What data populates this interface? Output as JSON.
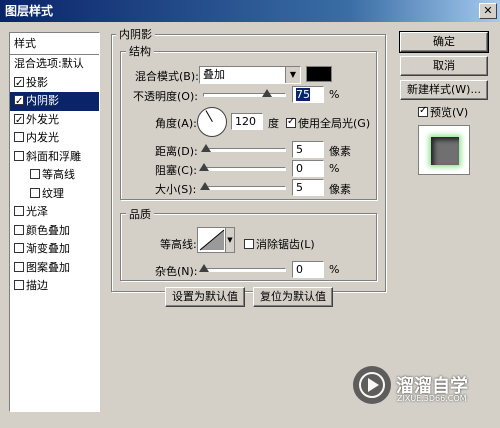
{
  "window": {
    "title": "图层样式",
    "close_glyph": "✕"
  },
  "styles_panel": {
    "header": "样式",
    "items": [
      {
        "label": "混合选项:默认",
        "checkbox": false,
        "checked": false,
        "indent": false,
        "selected": false
      },
      {
        "label": "投影",
        "checkbox": true,
        "checked": true,
        "indent": false,
        "selected": false
      },
      {
        "label": "内阴影",
        "checkbox": true,
        "checked": true,
        "indent": false,
        "selected": true
      },
      {
        "label": "外发光",
        "checkbox": true,
        "checked": true,
        "indent": false,
        "selected": false
      },
      {
        "label": "内发光",
        "checkbox": true,
        "checked": false,
        "indent": false,
        "selected": false
      },
      {
        "label": "斜面和浮雕",
        "checkbox": true,
        "checked": false,
        "indent": false,
        "selected": false
      },
      {
        "label": "等高线",
        "checkbox": true,
        "checked": false,
        "indent": true,
        "selected": false
      },
      {
        "label": "纹理",
        "checkbox": true,
        "checked": false,
        "indent": true,
        "selected": false
      },
      {
        "label": "光泽",
        "checkbox": true,
        "checked": false,
        "indent": false,
        "selected": false
      },
      {
        "label": "颜色叠加",
        "checkbox": true,
        "checked": false,
        "indent": false,
        "selected": false
      },
      {
        "label": "渐变叠加",
        "checkbox": true,
        "checked": false,
        "indent": false,
        "selected": false
      },
      {
        "label": "图案叠加",
        "checkbox": true,
        "checked": false,
        "indent": false,
        "selected": false
      },
      {
        "label": "描边",
        "checkbox": true,
        "checked": false,
        "indent": false,
        "selected": false
      }
    ]
  },
  "inner_shadow": {
    "section_title": "内阴影",
    "structure": {
      "title": "结构",
      "blend_mode_label": "混合模式(B):",
      "blend_mode_value": "叠加",
      "shadow_color": "#000000",
      "opacity_label": "不透明度(O):",
      "opacity_value": "75",
      "opacity_unit": "%",
      "angle_label": "角度(A):",
      "angle_value": "120",
      "angle_unit": "度",
      "use_global_light_label": "使用全局光(G)",
      "use_global_light_checked": true,
      "distance_label": "距离(D):",
      "distance_value": "5",
      "distance_unit": "像素",
      "choke_label": "阻塞(C):",
      "choke_value": "0",
      "choke_unit": "%",
      "size_label": "大小(S):",
      "size_value": "5",
      "size_unit": "像素"
    },
    "quality": {
      "title": "品质",
      "contour_label": "等高线:",
      "anti_alias_label": "消除锯齿(L)",
      "anti_alias_checked": false,
      "noise_label": "杂色(N):",
      "noise_value": "0",
      "noise_unit": "%"
    },
    "reset_default_button": "设置为默认值",
    "restore_default_button": "复位为默认值"
  },
  "actions": {
    "ok_button": "确定",
    "cancel_button": "取消",
    "new_style_button": "新建样式(W)...",
    "preview_label": "预览(V)",
    "preview_checked": true
  },
  "watermark": {
    "brand": "溜溜自学",
    "url": "ZIXUE.3D66.COM"
  },
  "colors": {
    "selection": "#0a246a",
    "dialog_bg": "#d4d0c8",
    "glow": "#8ee08e"
  }
}
